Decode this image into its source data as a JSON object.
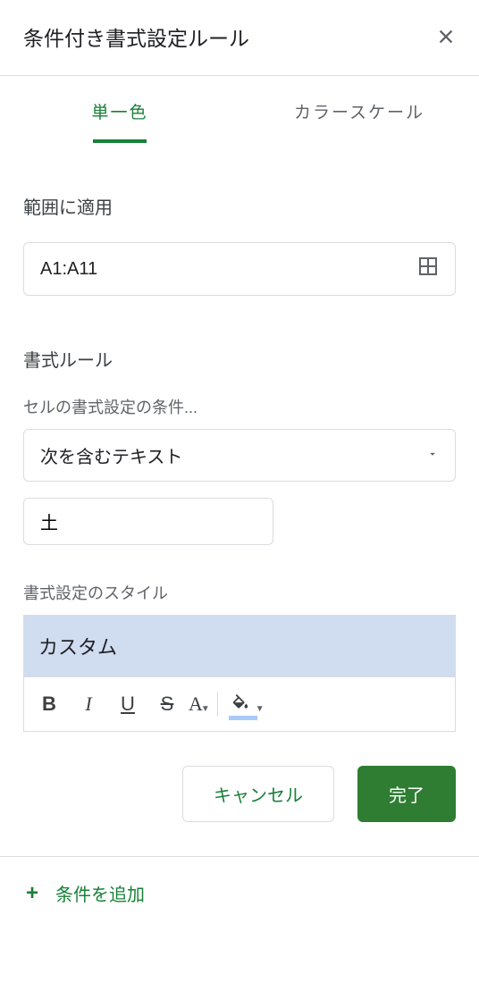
{
  "header": {
    "title": "条件付き書式設定ルール"
  },
  "tabs": {
    "single_color": "単一色",
    "color_scale": "カラースケール"
  },
  "labels": {
    "apply_to_range": "範囲に適用",
    "format_rules": "書式ルール",
    "format_condition": "セルの書式設定の条件...",
    "formatting_style": "書式設定のスタイル"
  },
  "inputs": {
    "range": "A1:A11",
    "condition_type": "次を含むテキスト",
    "condition_value": "土",
    "style_preview": "カスタム"
  },
  "buttons": {
    "cancel": "キャンセル",
    "done": "完了"
  },
  "footer": {
    "add_condition": "条件を追加"
  }
}
